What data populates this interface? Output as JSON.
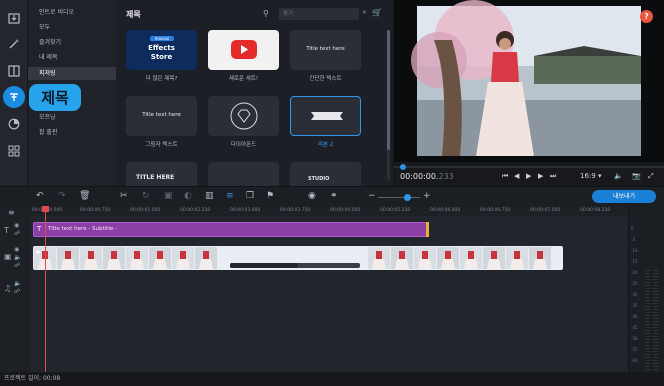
{
  "app": {
    "active_section": "제목"
  },
  "rail": {
    "icons": [
      "import-icon",
      "magic-wand-icon",
      "transitions-icon",
      "titles-icon",
      "stickers-icon",
      "more-tools-icon"
    ]
  },
  "tooltip": {
    "label": "제목"
  },
  "categories": [
    "인트로 비디오",
    "모두",
    "즐겨찾기",
    "내 제목",
    "피쳐링",
    "",
    "",
    "모프닝",
    "팝 출판"
  ],
  "categories_selected": 4,
  "browser": {
    "header": "제목",
    "search_placeholder": "찾기",
    "tiles": [
      {
        "caption": "더 많은 제목?",
        "thumb_top": "movavi",
        "thumb_main": "Effects",
        "thumb_sub": "Store",
        "kind": "store"
      },
      {
        "caption": "새로운 세트!",
        "kind": "youtube"
      },
      {
        "caption": "간단한 텍스트",
        "thumb_text": "Title text here",
        "kind": "simple"
      },
      {
        "caption": "그림자 텍스트",
        "thumb_text": "Title text here",
        "kind": "simple"
      },
      {
        "caption": "다이아몬드",
        "kind": "diamond"
      },
      {
        "caption": "리본 2",
        "kind": "ribbon",
        "selected": true
      },
      {
        "caption": "",
        "thumb_text": "TITLE HERE",
        "kind": "bold"
      },
      {
        "caption": "",
        "kind": "blank"
      },
      {
        "caption": "",
        "thumb_text": "STUDIO",
        "kind": "studio"
      }
    ]
  },
  "preview": {
    "help_label": "?",
    "timecode_main": "00:00:00.",
    "timecode_frac": "233",
    "aspect_ratio": "16:9"
  },
  "toolbar": {
    "export_label": "내보내기",
    "zoom_level": 0.68
  },
  "timeline": {
    "ruler_ticks": [
      "00:00:00.000",
      "00:00:00.750",
      "00:00:01.500",
      "00:00:02.250",
      "00:00:03.000",
      "00:00:03.750",
      "00:00:04.500",
      "00:00:05.250",
      "00:00:06.000",
      "00:00:06.750",
      "00:00:07.500",
      "00:00:08.250"
    ],
    "title_clip_label": "Title text here - Subtitle -",
    "project_length_label": "프로젝트 길이: 00:08"
  },
  "meter": {
    "labels": [
      "0",
      "-5",
      "-10",
      "-15",
      "-20",
      "-25",
      "-30",
      "-35",
      "-40",
      "-45",
      "-50",
      "-55",
      "-60"
    ]
  },
  "colors": {
    "accent": "#1a8de3",
    "title_clip": "#8d3fa8",
    "playhead": "#e14b4b",
    "help": "#e9553d"
  }
}
